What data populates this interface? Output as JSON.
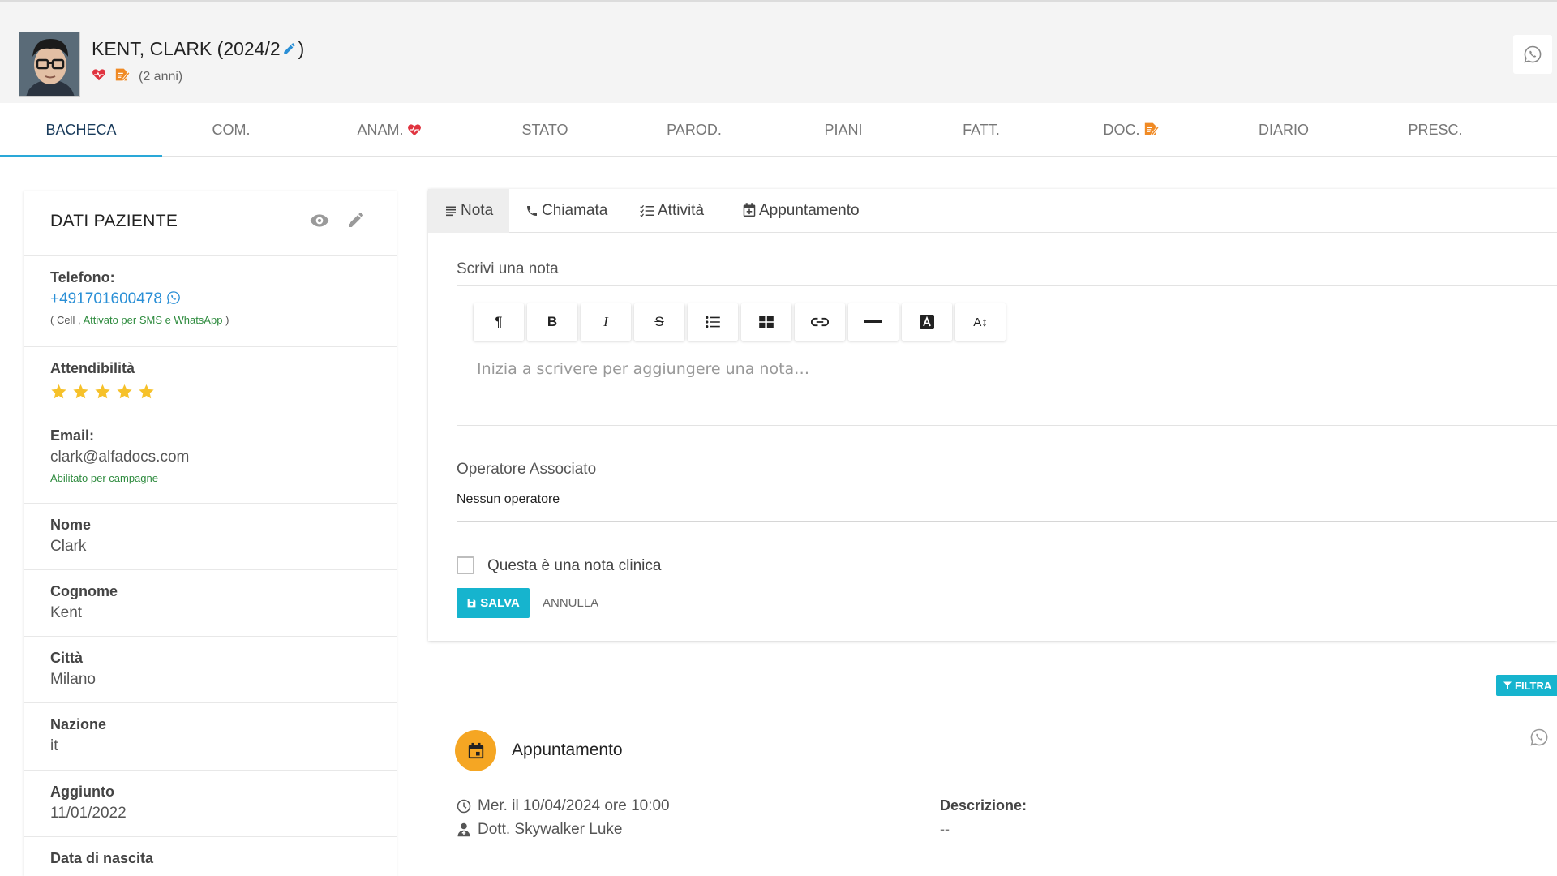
{
  "header": {
    "patient_name": "KENT, CLARK (2024/2",
    "name_close": ")",
    "age": "(2 anni)"
  },
  "tabs": [
    {
      "label": "BACHECA"
    },
    {
      "label": "COM."
    },
    {
      "label": "ANAM."
    },
    {
      "label": "STATO"
    },
    {
      "label": "PAROD."
    },
    {
      "label": "PIANI"
    },
    {
      "label": "FATT."
    },
    {
      "label": "DOC."
    },
    {
      "label": "DIARIO"
    },
    {
      "label": "PRESC."
    }
  ],
  "patient_panel": {
    "title": "DATI PAZIENTE",
    "phone": {
      "label": "Telefono:",
      "value": "+491701600478",
      "note_open": "( Cell ,",
      "note_green": "Attivato per SMS e WhatsApp",
      "note_close": ")"
    },
    "reliability": {
      "label": "Attendibilità",
      "rating": 5,
      "max": 5
    },
    "email": {
      "label": "Email:",
      "value": "clark@alfadocs.com",
      "note": "Abilitato per campagne"
    },
    "first_name": {
      "label": "Nome",
      "value": "Clark"
    },
    "last_name": {
      "label": "Cognome",
      "value": "Kent"
    },
    "city": {
      "label": "Città",
      "value": "Milano"
    },
    "country": {
      "label": "Nazione",
      "value": "it"
    },
    "added": {
      "label": "Aggiunto",
      "value": "11/01/2022"
    },
    "birth": {
      "label": "Data di nascita"
    }
  },
  "note_card": {
    "tabs": [
      {
        "label": "Nota"
      },
      {
        "label": "Chiamata"
      },
      {
        "label": "Attività"
      },
      {
        "label": "Appuntamento"
      }
    ],
    "note_label": "Scrivi una nota",
    "editor_placeholder": "Inizia a scrivere per aggiungere una nota…",
    "toolbar": {
      "paragraph": "¶",
      "bold": "B",
      "italic": "I",
      "strike": "S",
      "font_size": "A↕"
    },
    "operator_label": "Operatore Associato",
    "operator_value": "Nessun operatore",
    "clinical_label": "Questa è una nota clinica",
    "save_label": "SALVA",
    "cancel_label": "ANNULLA"
  },
  "filter_label": "FILTRA",
  "appointment": {
    "title": "Appuntamento",
    "datetime": "Mer. il 10/04/2024 ore 10:00",
    "doctor": "Dott. Skywalker Luke",
    "desc_label": "Descrizione:",
    "desc_value": "--"
  },
  "colors": {
    "accent_cyan": "#16b4ce",
    "link_blue": "#2a8fd6",
    "heart_red": "#e0333f",
    "doc_orange": "#f08a24",
    "star_yellow": "#f6c12a",
    "appt_orange": "#f5a623",
    "green_text": "#2e8b3e"
  }
}
